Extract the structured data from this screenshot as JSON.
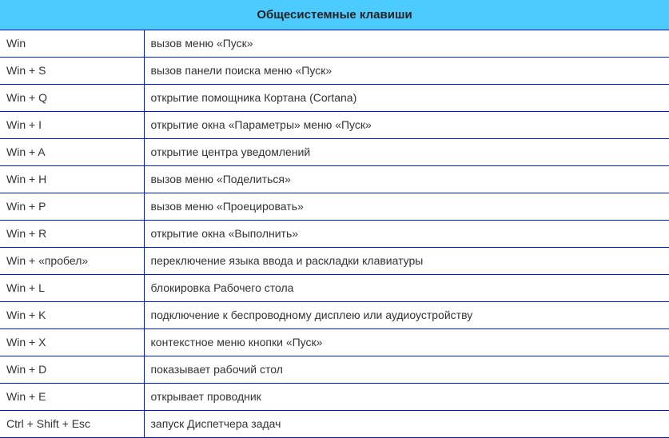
{
  "title": "Общесистемные клавиши",
  "rows": [
    {
      "key": "Win",
      "desc": "вызов меню «Пуск»"
    },
    {
      "key": "Win + S",
      "desc": "вызов панели поиска меню «Пуск»"
    },
    {
      "key": "Win + Q",
      "desc": "открытие помощника Кортана (Cortana)"
    },
    {
      "key": "Win + I",
      "desc": "открытие окна «Параметры» меню «Пуск»"
    },
    {
      "key": "Win + A",
      "desc": "открытие центра уведомлений"
    },
    {
      "key": "Win + H",
      "desc": "вызов меню «Поделиться»"
    },
    {
      "key": "Win + P",
      "desc": "вызов меню «Проецировать»"
    },
    {
      "key": "Win + R",
      "desc": "открытие окна «Выполнить»"
    },
    {
      "key": "Win + «пробел»",
      "desc": "переключение языка ввода и раскладки клавиатуры"
    },
    {
      "key": "Win + L",
      "desc": "блокировка Рабочего стола"
    },
    {
      "key": "Win + K",
      "desc": "подключение к беспроводному дисплею или аудиоустройству"
    },
    {
      "key": "Win + X",
      "desc": "контекстное меню кнопки «Пуск»"
    },
    {
      "key": "Win + D",
      "desc": "показывает рабочий стол"
    },
    {
      "key": "Win + E",
      "desc": "открывает проводник"
    },
    {
      "key": "Ctrl + Shift + Esc",
      "desc": "запуск Диспетчера задач"
    }
  ]
}
